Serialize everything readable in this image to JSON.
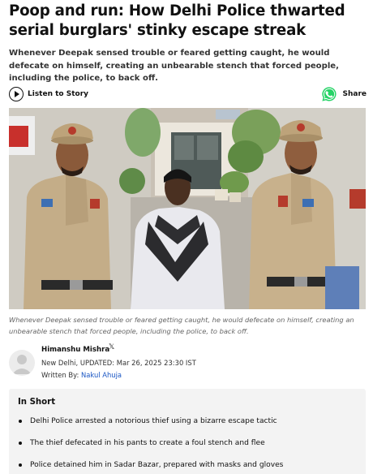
{
  "article": {
    "headline": "Poop and run: How Delhi Police thwarted serial burglars' stinky escape streak",
    "subheadline": "Whenever Deepak sensed trouble or feared getting caught, he would defecate on himself, creating an unbearable stench that forced people, including the police, to back off."
  },
  "toolbar": {
    "listen_label": "Listen to Story",
    "share_label": "Share",
    "listen_icon": "play-circle-icon",
    "share_icon": "whatsapp-icon",
    "brand_color": "#25d366"
  },
  "photo": {
    "caption": "Whenever Deepak sensed trouble or feared getting caught, he would defecate on himself, creating an unbearable stench that forced people, including the police, to back off."
  },
  "author": {
    "name": "Himanshu Mishra",
    "social_icon": "x-icon",
    "dateline": "New Delhi, UPDATED: Mar 26, 2025 23:30 IST",
    "written_by_label": "Written By:",
    "written_by_name": "Nakul Ahuja",
    "link_color": "#1a56c4"
  },
  "in_short": {
    "title": "In Short",
    "items": [
      "Delhi Police arrested a notorious thief using a bizarre escape tactic",
      "The thief defecated in his pants to create a foul stench and flee",
      "Police detained him in Sadar Bazar, prepared with masks and gloves"
    ]
  }
}
